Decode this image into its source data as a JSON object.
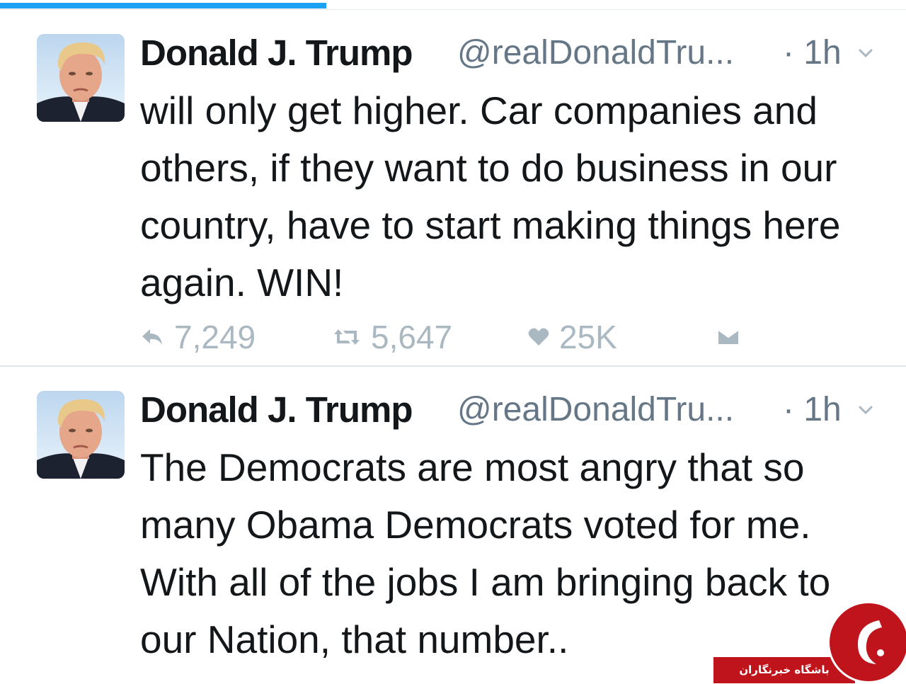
{
  "progress": {
    "fraction": 0.36
  },
  "tweets": [
    {
      "name": "Donald J. Trump",
      "handle": "@realDonaldTru...",
      "time": "· 1h",
      "text": "will only get higher. Car companies and others, if they want to do business in our country, have to start making things here again. WIN!",
      "reply_count": "7,249",
      "retweet_count": "5,647",
      "like_count": "25K"
    },
    {
      "name": "Donald J. Trump",
      "handle": "@realDonaldTru...",
      "time": "· 1h",
      "text": "The Democrats are most angry that so many Obama Democrats voted for me. With all of the jobs I am bringing back to our Nation, that number.."
    }
  ],
  "icons": {
    "reply": "reply-icon",
    "retweet": "retweet-icon",
    "like": "heart-icon",
    "dm": "envelope-icon",
    "caret": "chevron-down-icon"
  },
  "watermark": {
    "text": "باشگاه خبرنگاران"
  },
  "colors": {
    "accent": "#1da1f2",
    "muted": "#657786",
    "action": "#aab8c2",
    "watermark_red": "#c0141c"
  }
}
